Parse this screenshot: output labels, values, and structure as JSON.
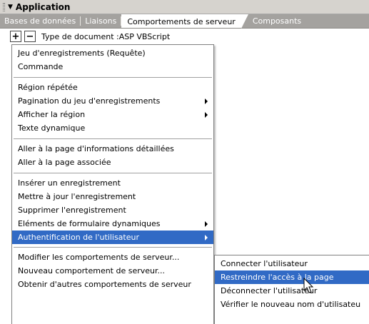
{
  "panel": {
    "title": "Application"
  },
  "tabs": [
    "Bases de données",
    "Liaisons",
    "Comportements de serveur",
    "Composants"
  ],
  "toolbar": {
    "add_label": "+",
    "remove_label": "−",
    "doc_type": "Type de document :ASP VBScript"
  },
  "menu": {
    "items": [
      {
        "label": "Jeu d'enregistrements (Requête)"
      },
      {
        "label": "Commande"
      },
      {
        "label": "Région répétée"
      },
      {
        "label": "Pagination du jeu d'enregistrements"
      },
      {
        "label": "Afficher la région"
      },
      {
        "label": "Texte dynamique"
      },
      {
        "label": "Aller à la page d'informations détaillées"
      },
      {
        "label": "Aller à la page associée"
      },
      {
        "label": "Insérer un enregistrement"
      },
      {
        "label": "Mettre à jour l'enregistrement"
      },
      {
        "label": "Supprimer l'enregistrement"
      },
      {
        "label": "Eléments de formulaire dynamiques"
      },
      {
        "label": "Authentification de l'utilisateur"
      },
      {
        "label": "Modifier les comportements de serveur..."
      },
      {
        "label": "Nouveau comportement de serveur..."
      },
      {
        "label": "Obtenir d'autres comportements de serveur"
      }
    ]
  },
  "submenu": {
    "items": [
      {
        "label": "Connecter l'utilisateur"
      },
      {
        "label": "Restreindre l'accès à la page"
      },
      {
        "label": "Déconnecter l'utilisateur"
      },
      {
        "label": "Vérifier le nouveau nom d'utilisateu"
      }
    ]
  }
}
